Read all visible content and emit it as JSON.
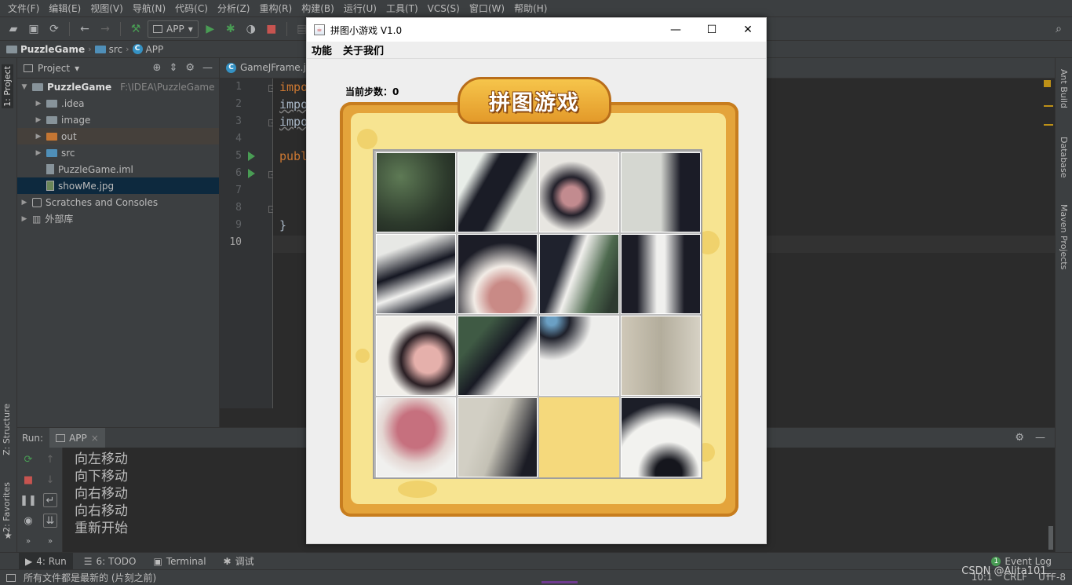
{
  "menu": [
    "文件(F)",
    "编辑(E)",
    "视图(V)",
    "导航(N)",
    "代码(C)",
    "分析(Z)",
    "重构(R)",
    "构建(B)",
    "运行(U)",
    "工具(T)",
    "VCS(S)",
    "窗口(W)",
    "帮助(H)"
  ],
  "toolbar": {
    "run_config": "APP"
  },
  "breadcrumb": {
    "project": "PuzzleGame",
    "src": "src",
    "class": "APP"
  },
  "project_panel": {
    "title": "Project",
    "root": {
      "name": "PuzzleGame",
      "path": "F:\\IDEA\\PuzzleGame"
    },
    "items": [
      ".idea",
      "image",
      "out",
      "src",
      "PuzzleGame.iml",
      "showMe.jpg"
    ],
    "scratches": "Scratches and Consoles",
    "external": "外部库"
  },
  "editor": {
    "tab": "GameJFrame.j",
    "line_numbers": [
      "1",
      "2",
      "3",
      "4",
      "5",
      "6",
      "7",
      "8",
      "9",
      "10"
    ],
    "lines": [
      "impo",
      "impo",
      "impo",
      "",
      "publ",
      "",
      "",
      "",
      "}",
      ""
    ]
  },
  "left_stripe": {
    "project": "1: Project",
    "structure": "Z: Structure",
    "favorites": "2: Favorites"
  },
  "right_stripe": {
    "ant": "Ant Build",
    "database": "Database",
    "maven": "Maven Projects"
  },
  "run_panel": {
    "label": "Run:",
    "tab": "APP",
    "console": [
      "向左移动",
      "向下移动",
      "向右移动",
      "向右移动",
      "重新开始"
    ]
  },
  "bottom_tabs": {
    "run": "4: Run",
    "todo": "6: TODO",
    "terminal": "Terminal",
    "debug": "调试",
    "event_log": "Event Log"
  },
  "status": {
    "message": "所有文件都是最新的 (片刻之前)",
    "position": "10:1",
    "line_sep": "CRLF",
    "encoding": "UTF-8",
    "watermark": "CSDN @Alita101_"
  },
  "game": {
    "title": "拼图小游戏 V1.0",
    "menu": [
      "功能",
      "关于我们"
    ],
    "steps_label": "当前步数：",
    "steps_value": "0",
    "banner": "拼图游戏"
  },
  "colors": {
    "ide_bg": "#2b2b2b",
    "panel_bg": "#3c3f41",
    "board_frame": "#e4a43b",
    "board_inner": "#f7e491",
    "keyword": "#cc7832"
  }
}
